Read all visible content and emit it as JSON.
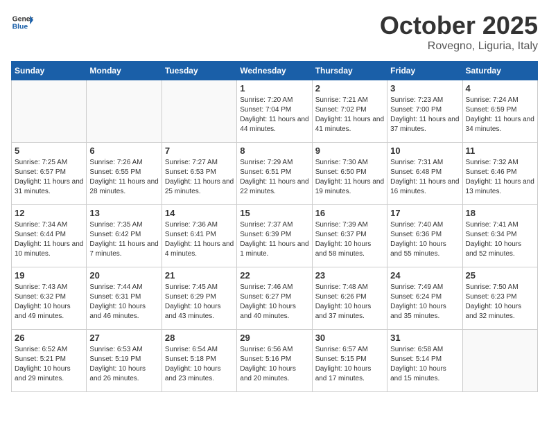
{
  "header": {
    "logo_general": "General",
    "logo_blue": "Blue",
    "title": "October 2025",
    "location": "Rovegno, Liguria, Italy"
  },
  "weekdays": [
    "Sunday",
    "Monday",
    "Tuesday",
    "Wednesday",
    "Thursday",
    "Friday",
    "Saturday"
  ],
  "weeks": [
    [
      {
        "day": "",
        "empty": true
      },
      {
        "day": "",
        "empty": true
      },
      {
        "day": "",
        "empty": true
      },
      {
        "day": "1",
        "sunrise": "7:20 AM",
        "sunset": "7:04 PM",
        "daylight": "11 hours and 44 minutes."
      },
      {
        "day": "2",
        "sunrise": "7:21 AM",
        "sunset": "7:02 PM",
        "daylight": "11 hours and 41 minutes."
      },
      {
        "day": "3",
        "sunrise": "7:23 AM",
        "sunset": "7:00 PM",
        "daylight": "11 hours and 37 minutes."
      },
      {
        "day": "4",
        "sunrise": "7:24 AM",
        "sunset": "6:59 PM",
        "daylight": "11 hours and 34 minutes."
      }
    ],
    [
      {
        "day": "5",
        "sunrise": "7:25 AM",
        "sunset": "6:57 PM",
        "daylight": "11 hours and 31 minutes."
      },
      {
        "day": "6",
        "sunrise": "7:26 AM",
        "sunset": "6:55 PM",
        "daylight": "11 hours and 28 minutes."
      },
      {
        "day": "7",
        "sunrise": "7:27 AM",
        "sunset": "6:53 PM",
        "daylight": "11 hours and 25 minutes."
      },
      {
        "day": "8",
        "sunrise": "7:29 AM",
        "sunset": "6:51 PM",
        "daylight": "11 hours and 22 minutes."
      },
      {
        "day": "9",
        "sunrise": "7:30 AM",
        "sunset": "6:50 PM",
        "daylight": "11 hours and 19 minutes."
      },
      {
        "day": "10",
        "sunrise": "7:31 AM",
        "sunset": "6:48 PM",
        "daylight": "11 hours and 16 minutes."
      },
      {
        "day": "11",
        "sunrise": "7:32 AM",
        "sunset": "6:46 PM",
        "daylight": "11 hours and 13 minutes."
      }
    ],
    [
      {
        "day": "12",
        "sunrise": "7:34 AM",
        "sunset": "6:44 PM",
        "daylight": "11 hours and 10 minutes."
      },
      {
        "day": "13",
        "sunrise": "7:35 AM",
        "sunset": "6:42 PM",
        "daylight": "11 hours and 7 minutes."
      },
      {
        "day": "14",
        "sunrise": "7:36 AM",
        "sunset": "6:41 PM",
        "daylight": "11 hours and 4 minutes."
      },
      {
        "day": "15",
        "sunrise": "7:37 AM",
        "sunset": "6:39 PM",
        "daylight": "11 hours and 1 minute."
      },
      {
        "day": "16",
        "sunrise": "7:39 AM",
        "sunset": "6:37 PM",
        "daylight": "10 hours and 58 minutes."
      },
      {
        "day": "17",
        "sunrise": "7:40 AM",
        "sunset": "6:36 PM",
        "daylight": "10 hours and 55 minutes."
      },
      {
        "day": "18",
        "sunrise": "7:41 AM",
        "sunset": "6:34 PM",
        "daylight": "10 hours and 52 minutes."
      }
    ],
    [
      {
        "day": "19",
        "sunrise": "7:43 AM",
        "sunset": "6:32 PM",
        "daylight": "10 hours and 49 minutes."
      },
      {
        "day": "20",
        "sunrise": "7:44 AM",
        "sunset": "6:31 PM",
        "daylight": "10 hours and 46 minutes."
      },
      {
        "day": "21",
        "sunrise": "7:45 AM",
        "sunset": "6:29 PM",
        "daylight": "10 hours and 43 minutes."
      },
      {
        "day": "22",
        "sunrise": "7:46 AM",
        "sunset": "6:27 PM",
        "daylight": "10 hours and 40 minutes."
      },
      {
        "day": "23",
        "sunrise": "7:48 AM",
        "sunset": "6:26 PM",
        "daylight": "10 hours and 37 minutes."
      },
      {
        "day": "24",
        "sunrise": "7:49 AM",
        "sunset": "6:24 PM",
        "daylight": "10 hours and 35 minutes."
      },
      {
        "day": "25",
        "sunrise": "7:50 AM",
        "sunset": "6:23 PM",
        "daylight": "10 hours and 32 minutes."
      }
    ],
    [
      {
        "day": "26",
        "sunrise": "6:52 AM",
        "sunset": "5:21 PM",
        "daylight": "10 hours and 29 minutes."
      },
      {
        "day": "27",
        "sunrise": "6:53 AM",
        "sunset": "5:19 PM",
        "daylight": "10 hours and 26 minutes."
      },
      {
        "day": "28",
        "sunrise": "6:54 AM",
        "sunset": "5:18 PM",
        "daylight": "10 hours and 23 minutes."
      },
      {
        "day": "29",
        "sunrise": "6:56 AM",
        "sunset": "5:16 PM",
        "daylight": "10 hours and 20 minutes."
      },
      {
        "day": "30",
        "sunrise": "6:57 AM",
        "sunset": "5:15 PM",
        "daylight": "10 hours and 17 minutes."
      },
      {
        "day": "31",
        "sunrise": "6:58 AM",
        "sunset": "5:14 PM",
        "daylight": "10 hours and 15 minutes."
      },
      {
        "day": "",
        "empty": true
      }
    ]
  ]
}
